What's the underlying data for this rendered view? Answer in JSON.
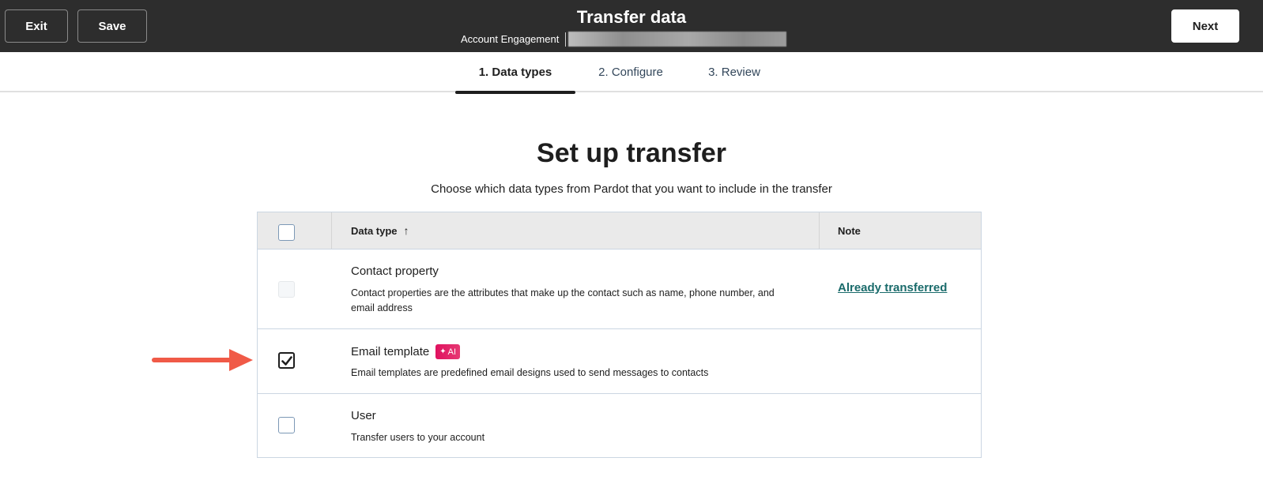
{
  "header": {
    "exit_label": "Exit",
    "save_label": "Save",
    "title": "Transfer data",
    "subtitle": "Account Engagement",
    "next_label": "Next"
  },
  "tabs": [
    {
      "label": "1. Data types",
      "active": true
    },
    {
      "label": "2. Configure",
      "active": false
    },
    {
      "label": "3. Review",
      "active": false
    }
  ],
  "main": {
    "heading": "Set up transfer",
    "description": "Choose which data types from Pardot that you want to include in the transfer"
  },
  "table": {
    "columns": {
      "data_type": "Data type",
      "sort_icon": "arrow-up-icon",
      "note": "Note"
    },
    "rows": [
      {
        "title": "Contact property",
        "description": "Contact properties are the attributes that make up the contact such as name, phone number, and email address",
        "checked": false,
        "disabled": true,
        "note": "Already transferred"
      },
      {
        "title": "Email template",
        "badge": "AI",
        "description": "Email templates are predefined email designs used to send messages to contacts",
        "checked": true,
        "disabled": false,
        "note": ""
      },
      {
        "title": "User",
        "description": "Transfer users to your account",
        "checked": false,
        "disabled": false,
        "note": ""
      }
    ]
  },
  "colors": {
    "header_bg": "#2d2d2d",
    "link": "#1a6b6b",
    "ai_badge": "#e0115f",
    "annotation_arrow": "#f05a47"
  }
}
